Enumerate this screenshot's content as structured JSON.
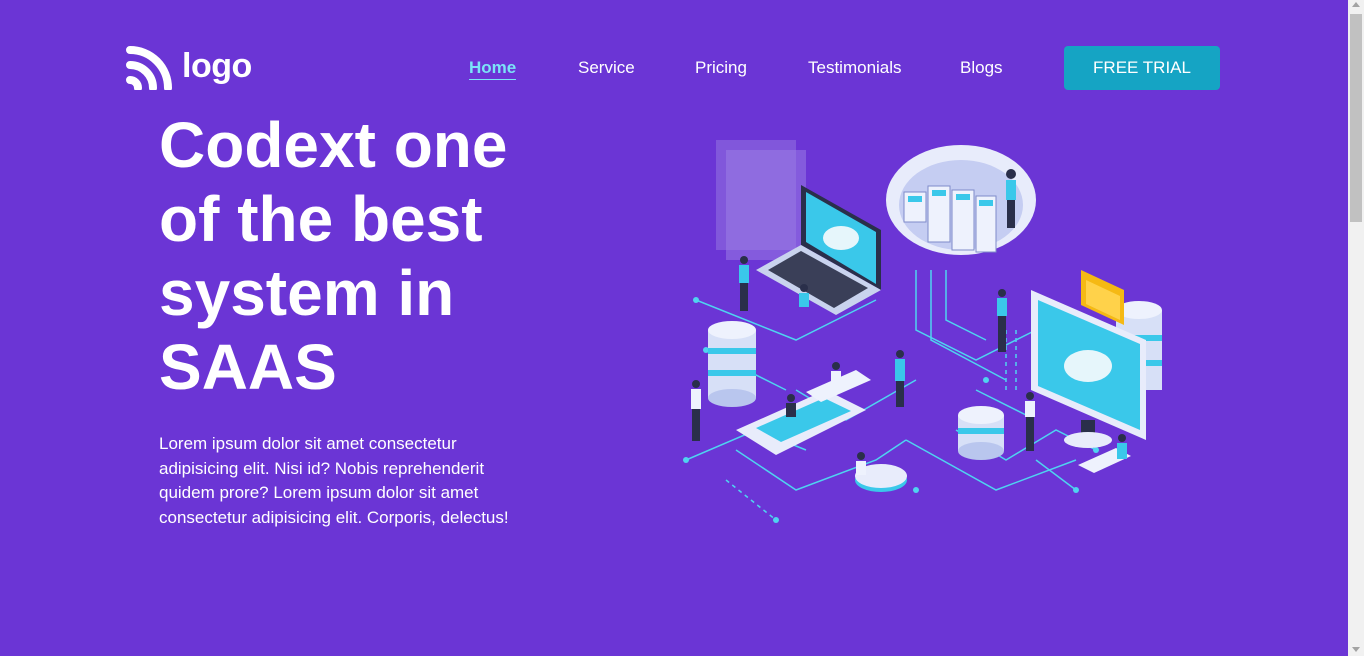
{
  "brand": {
    "logo_text": "logo"
  },
  "nav": {
    "items": [
      {
        "label": "Home",
        "active": true
      },
      {
        "label": "Service",
        "active": false
      },
      {
        "label": "Pricing",
        "active": false
      },
      {
        "label": "Testimonials",
        "active": false
      },
      {
        "label": "Blogs",
        "active": false
      }
    ],
    "cta_label": "FREE TRIAL"
  },
  "hero": {
    "title": "Codext one of the best system in SAAS",
    "description": "Lorem ipsum dolor sit amet consectetur adipisicing elit. Nisi id? Nobis reprehenderit quidem prore? Lorem ipsum dolor sit amet consectetur adipisicing elit. Corporis, delectus!"
  },
  "colors": {
    "background": "#6b35d5",
    "accent": "#15a4c4",
    "active_link": "#7be3f7"
  }
}
